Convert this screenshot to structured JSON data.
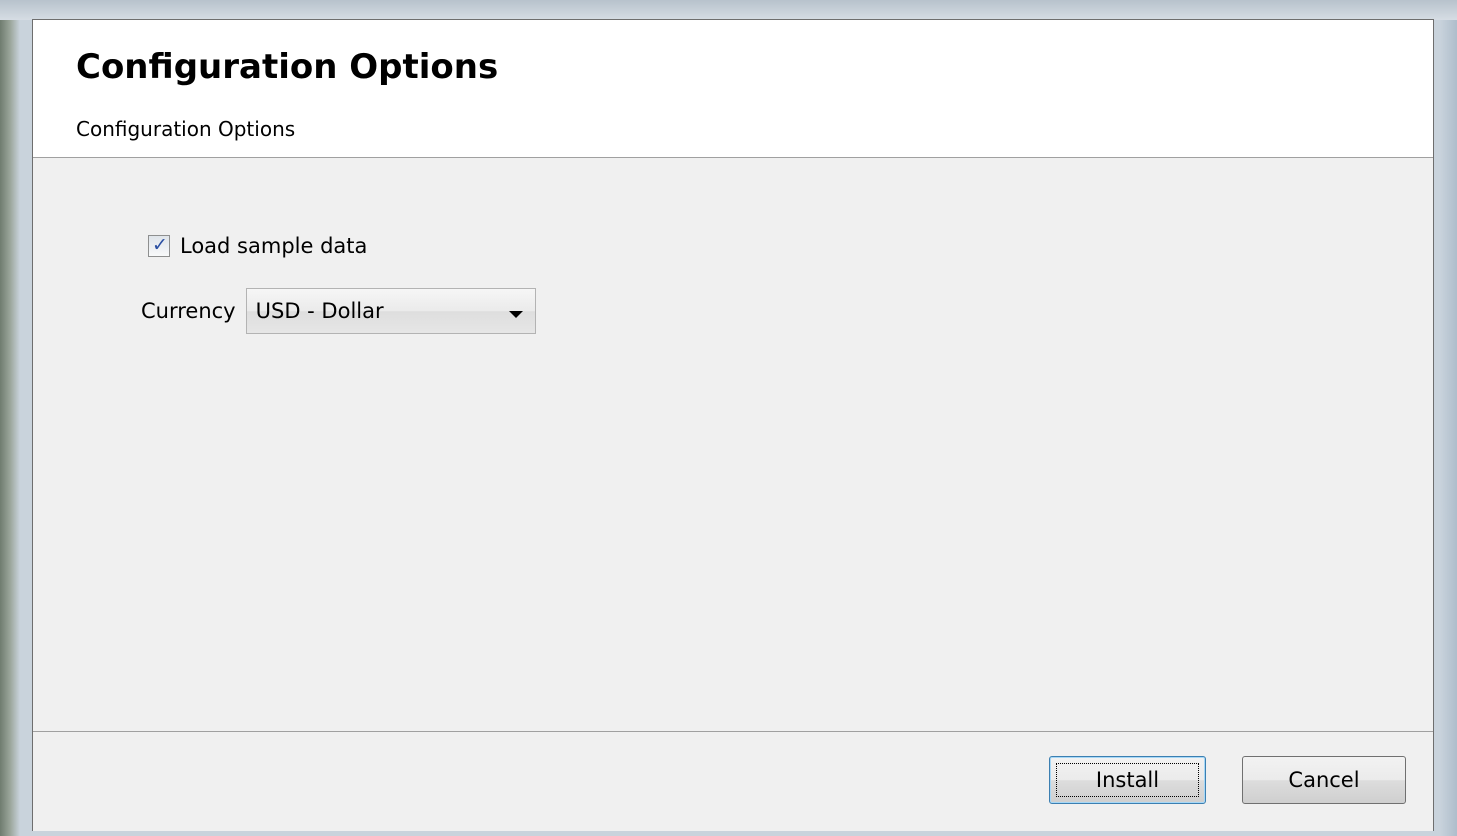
{
  "header": {
    "title": "Configuration Options",
    "subtitle": "Configuration Options"
  },
  "options": {
    "load_sample_data": {
      "label": "Load sample data",
      "checked": true
    },
    "currency": {
      "label": "Currency",
      "value": "USD - Dollar"
    }
  },
  "footer": {
    "install_label": "Install",
    "cancel_label": "Cancel"
  },
  "icons": {
    "checkbox_tick": "check-icon",
    "dropdown_arrow": "chevron-down-icon"
  },
  "colors": {
    "header_bg": "#ffffff",
    "body_bg": "#f0f0f0",
    "check_color": "#2b4fa3",
    "default_button_border": "#3c7fb1"
  }
}
